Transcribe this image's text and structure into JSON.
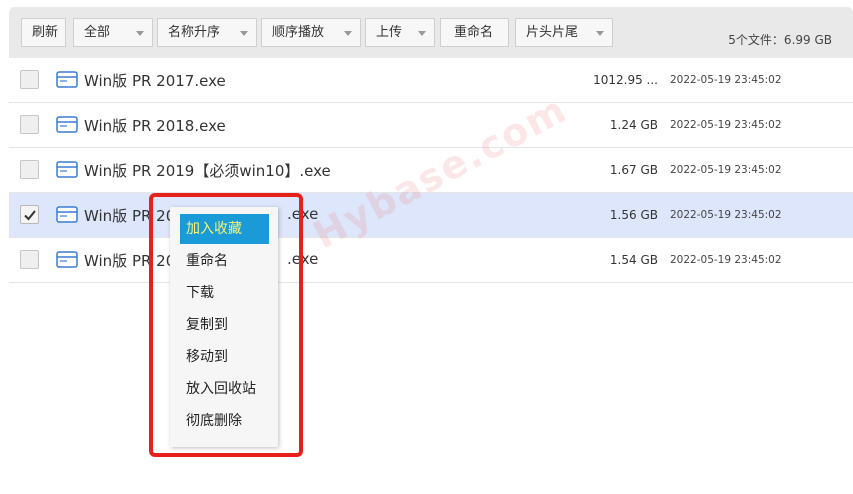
{
  "toolbar": {
    "refresh": "刷新",
    "filter": "全部",
    "sort": "名称升序",
    "playback": "顺序播放",
    "upload": "上传",
    "rename": "重命名",
    "intro_outro": "片头片尾",
    "summary": "5个文件：6.99 GB"
  },
  "files": [
    {
      "name": "Win版 PR 2017.exe",
      "size": "1012.95 ...",
      "date": "2022-05-19 23:45:02",
      "checked": false
    },
    {
      "name": "Win版 PR 2018.exe",
      "size": "1.24 GB",
      "date": "2022-05-19 23:45:02",
      "checked": false
    },
    {
      "name": "Win版 PR 2019【必须win10】.exe",
      "size": "1.67 GB",
      "date": "2022-05-19 23:45:02",
      "checked": false
    },
    {
      "name": "Win版 PR 20",
      "name_tail": ".exe",
      "size": "1.56 GB",
      "date": "2022-05-19 23:45:02",
      "checked": true
    },
    {
      "name": "Win版 PR 20",
      "name_tail": ".exe",
      "size": "1.54 GB",
      "date": "2022-05-19 23:45:02",
      "checked": false
    }
  ],
  "context_menu": {
    "items": [
      "加入收藏",
      "重命名",
      "下载",
      "复制到",
      "移动到",
      "放入回收站",
      "彻底删除"
    ]
  },
  "watermark": "Hybase.com",
  "colors": {
    "menu_highlight": "#1a9bd7",
    "selected_row": "#dde6fb",
    "annotation_box": "#e8201a",
    "file_icon": "#3a7bd5"
  }
}
